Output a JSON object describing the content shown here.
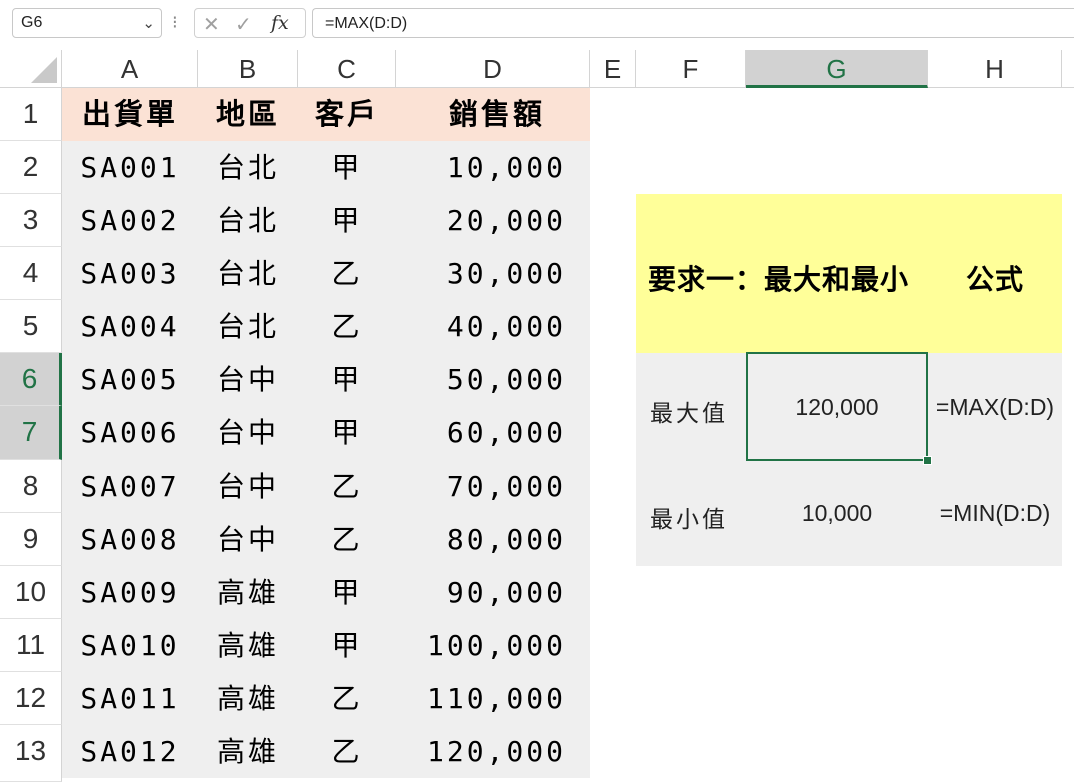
{
  "formula_bar": {
    "name_box": "G6",
    "chevron": "⌄",
    "cancel_icon": "✕",
    "enter_icon": "✓",
    "fx_icon": "fx",
    "formula": "=MAX(D:D)"
  },
  "columns": [
    "A",
    "B",
    "C",
    "D",
    "E",
    "F",
    "G",
    "H"
  ],
  "rows": [
    "1",
    "2",
    "3",
    "4",
    "5",
    "6",
    "7",
    "8",
    "9",
    "10",
    "11",
    "12",
    "13"
  ],
  "table": {
    "headers": [
      "出貨單",
      "地區",
      "客戶",
      "銷售額"
    ],
    "data": [
      [
        "SA001",
        "台北",
        "甲",
        "10,000"
      ],
      [
        "SA002",
        "台北",
        "甲",
        "20,000"
      ],
      [
        "SA003",
        "台北",
        "乙",
        "30,000"
      ],
      [
        "SA004",
        "台北",
        "乙",
        "40,000"
      ],
      [
        "SA005",
        "台中",
        "甲",
        "50,000"
      ],
      [
        "SA006",
        "台中",
        "甲",
        "60,000"
      ],
      [
        "SA007",
        "台中",
        "乙",
        "70,000"
      ],
      [
        "SA008",
        "台中",
        "乙",
        "80,000"
      ],
      [
        "SA009",
        "高雄",
        "甲",
        "90,000"
      ],
      [
        "SA010",
        "高雄",
        "甲",
        "100,000"
      ],
      [
        "SA011",
        "高雄",
        "乙",
        "110,000"
      ],
      [
        "SA012",
        "高雄",
        "乙",
        "120,000"
      ]
    ]
  },
  "summary": {
    "title": "要求一：最大和最小",
    "formula_header": "公式",
    "max_label": "最大值",
    "max_value": "120,000",
    "max_formula": "=MAX(D:D)",
    "min_label": "最小值",
    "min_value": "10,000",
    "min_formula": "=MIN(D:D)"
  },
  "colors": {
    "accent": "#217346",
    "header_fill": "#fbe2d5",
    "data_fill": "#efefef",
    "yellow_fill": "#ffff99"
  }
}
